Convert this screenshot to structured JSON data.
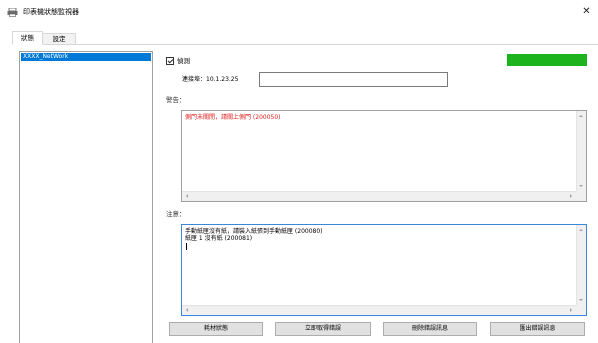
{
  "window": {
    "title": "印表機狀態監視器",
    "close_glyph": "✕"
  },
  "tabs": [
    {
      "label": "狀態"
    },
    {
      "label": "設定"
    }
  ],
  "printer_list": [
    {
      "name": "XXXX_NetWork"
    }
  ],
  "detect": {
    "label": "偵測",
    "checked": true,
    "status_color": "#1db31d"
  },
  "connection": {
    "label": "連接埠：10.1.23.25",
    "value": ""
  },
  "warning": {
    "label": "警告：",
    "messages": "側門未關閉，請關上側門 (200050)",
    "text_color": "#e02020"
  },
  "notice": {
    "label": "注意：",
    "messages": "手動紙匣沒有紙，請裝入紙張到手動紙匣 (200080)\n紙匣 1 沒有紙 (200081)"
  },
  "buttons": {
    "supplies": "耗材狀態",
    "get_errors": "立即取得錯誤",
    "delete_errors": "刪除錯誤訊息",
    "export_errors": "匯出錯誤訊息"
  }
}
